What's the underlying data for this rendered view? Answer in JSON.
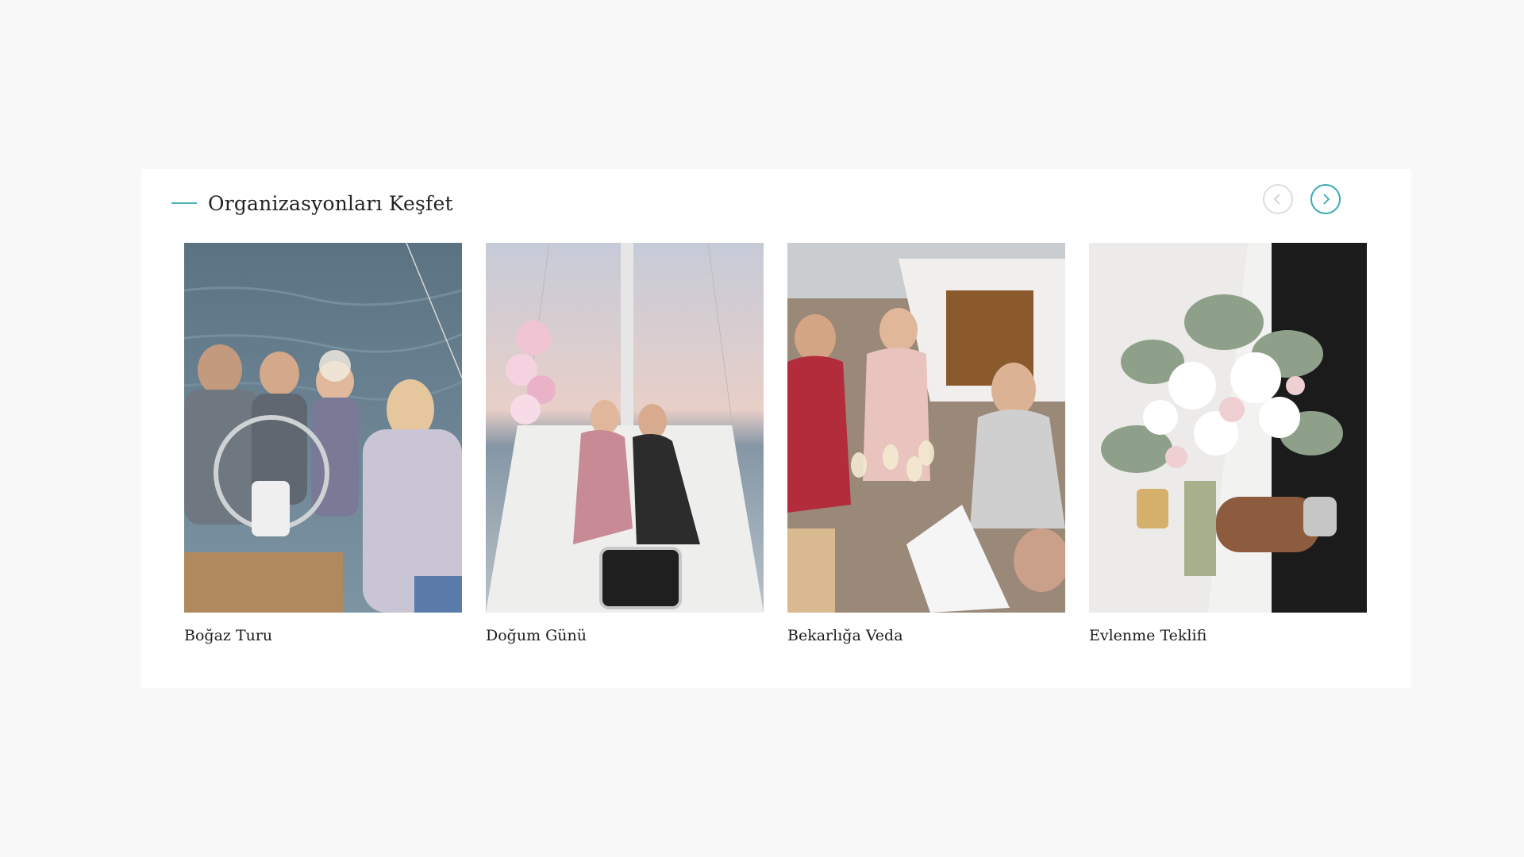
{
  "section": {
    "title": "Organizasyonları Keşfet",
    "accent_color": "#4ab0bd"
  },
  "nav": {
    "prev_icon": "chevron-left-icon",
    "next_icon": "chevron-right-icon"
  },
  "cards": [
    {
      "label": "Boğaz Turu",
      "image": "family-sailing-photo"
    },
    {
      "label": "Doğum Günü",
      "image": "birthday-on-yacht-photo"
    },
    {
      "label": "Bekarlığa Veda",
      "image": "bachelorette-toast-photo"
    },
    {
      "label": "Evlenme Teklifi",
      "image": "flower-bouquet-photo"
    }
  ]
}
